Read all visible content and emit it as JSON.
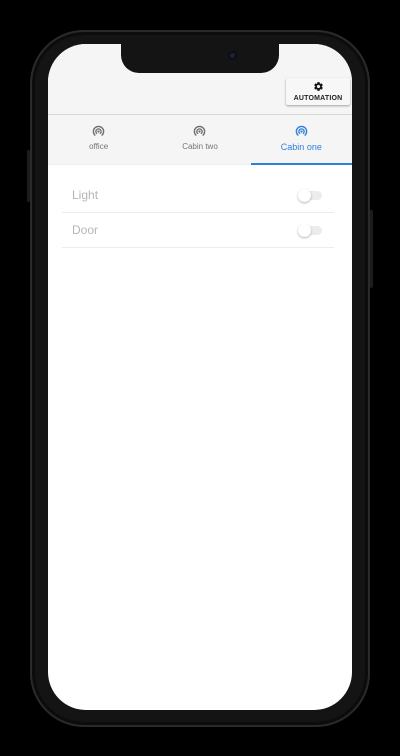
{
  "header": {
    "automation_label": "AUTOMATION",
    "automation_icon": "gear-icon"
  },
  "tabs": [
    {
      "label": "office",
      "icon": "broadcast-icon",
      "active": false
    },
    {
      "label": "Cabin two",
      "icon": "broadcast-icon",
      "active": false
    },
    {
      "label": "Cabin one",
      "icon": "broadcast-icon",
      "active": true
    }
  ],
  "devices": [
    {
      "label": "Light",
      "on": false
    },
    {
      "label": "Door",
      "on": false
    }
  ],
  "colors": {
    "accent": "#2f7fd8",
    "inactive_icon": "#6f6f6f",
    "app_bar": "#f5f5f5"
  }
}
